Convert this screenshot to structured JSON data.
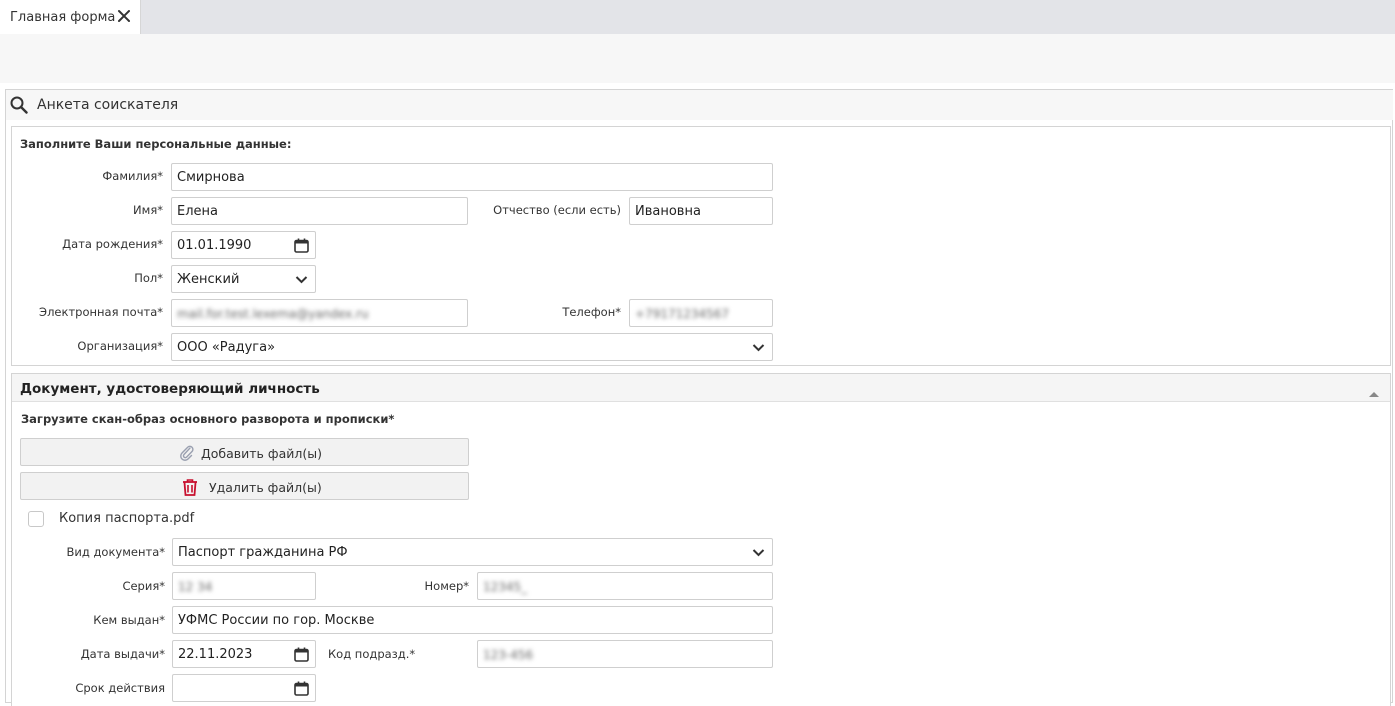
{
  "tab": {
    "title": "Главная форма"
  },
  "search": {
    "title": "Анкета соискателя"
  },
  "personal": {
    "heading": "Заполните Ваши персональные данные:",
    "surname": {
      "label": "Фамилия*",
      "value": "Смирнова"
    },
    "name": {
      "label": "Имя*",
      "value": "Елена"
    },
    "patronymic": {
      "label": "Отчество (если есть)",
      "value": "Ивановна"
    },
    "birthdate": {
      "label": "Дата рождения*",
      "value": "01.01.1990"
    },
    "gender": {
      "label": "Пол*",
      "value": "Женский"
    },
    "email": {
      "label": "Электронная почта*",
      "value": "mail.for.test.lexema@yandex.ru"
    },
    "phone": {
      "label": "Телефон*",
      "value": "+79171234567"
    },
    "organization": {
      "label": "Организация*",
      "value": "ООО «Радуга»"
    }
  },
  "document": {
    "title": "Документ, удостоверяющий личность",
    "upload_heading": "Загрузите скан-образ основного разворота и прописки*",
    "add_files": "Добавить файл(ы)",
    "delete_files": "Удалить файл(ы)",
    "file_name": "Копия паспорта.pdf",
    "doc_type": {
      "label": "Вид документа*",
      "value": "Паспорт гражданина РФ"
    },
    "series": {
      "label": "Серия*",
      "value": "12 34"
    },
    "number": {
      "label": "Номер*",
      "value": "12345_"
    },
    "issued_by": {
      "label": "Кем выдан*",
      "value": "УФМС России по гор. Москве"
    },
    "issue_date": {
      "label": "Дата выдачи*",
      "value": "22.11.2023"
    },
    "dept_code": {
      "label": "Код подразд.*",
      "value": "123-456"
    },
    "valid_until": {
      "label": "Срок действия",
      "value": ""
    }
  },
  "colors": {
    "tabbar": "#e3e4e8",
    "border": "#d4d4d4",
    "trash_icon": "#c8102e",
    "paperclip_icon": "#9aa0b0"
  },
  "icons": [
    "close-icon",
    "search-icon",
    "calendar-icon",
    "chevron-down-icon",
    "chevron-up-icon",
    "paperclip-icon",
    "trash-icon"
  ]
}
